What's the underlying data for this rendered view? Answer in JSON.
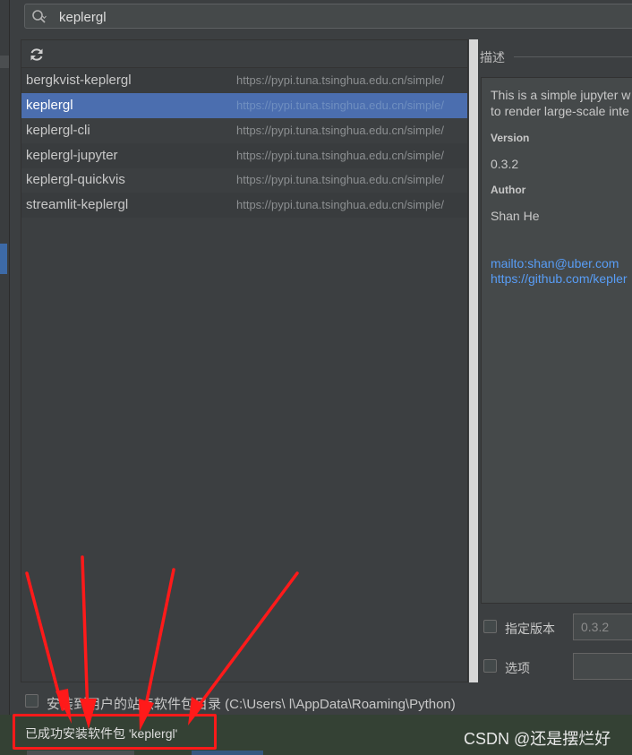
{
  "search": {
    "value": "keplergl"
  },
  "packages": [
    {
      "name": "bergkvist-keplergl",
      "url": "https://pypi.tuna.tsinghua.edu.cn/simple/",
      "selected": false
    },
    {
      "name": "keplergl",
      "url": "https://pypi.tuna.tsinghua.edu.cn/simple/",
      "selected": true
    },
    {
      "name": "keplergl-cli",
      "url": "https://pypi.tuna.tsinghua.edu.cn/simple/",
      "selected": false
    },
    {
      "name": "keplergl-jupyter",
      "url": "https://pypi.tuna.tsinghua.edu.cn/simple/",
      "selected": false
    },
    {
      "name": "keplergl-quickvis",
      "url": "https://pypi.tuna.tsinghua.edu.cn/simple/",
      "selected": false
    },
    {
      "name": "streamlit-keplergl",
      "url": "https://pypi.tuna.tsinghua.edu.cn/simple/",
      "selected": false
    }
  ],
  "description": {
    "title": "描述",
    "line1": "This is a simple jupyter w",
    "line2": "to render large-scale inte",
    "version_label": "Version",
    "version_value": "0.3.2",
    "author_label": "Author",
    "author_value": "Shan He",
    "link_email": "mailto:shan@uber.com",
    "link_github": "https://github.com/kepler"
  },
  "options": {
    "specify_version_label": "指定版本",
    "specify_version_value": "0.3.2",
    "options_label": "选项",
    "options_value": ""
  },
  "install_to_user_label": "安装到用户的站点软件包目录 (C:\\Users\\        l\\AppData\\Roaming\\Python)",
  "status": {
    "message": "已成功安装软件包 'keplergl'"
  },
  "watermark": "CSDN @还是摆烂好",
  "colors": {
    "selected_row": "#4b6eaf",
    "link": "#589df6",
    "annotation_red": "#ff1a1a",
    "status_bar": "#344134"
  }
}
